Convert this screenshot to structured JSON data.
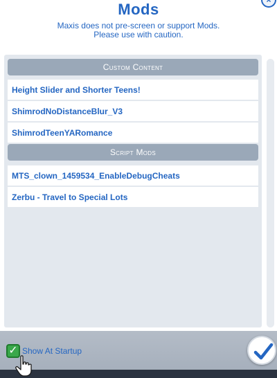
{
  "dialog": {
    "title": "Mods",
    "close_glyph": "×",
    "warning_line1": "Maxis does not pre-screen or support Mods.",
    "warning_line2": "Please use with caution."
  },
  "sections": {
    "custom_content": {
      "header": "Custom Content",
      "items": [
        "Height Slider and Shorter Teens!",
        "ShimrodNoDistanceBlur_V3",
        "ShimrodTeenYARomance"
      ]
    },
    "script_mods": {
      "header": "Script Mods",
      "items": [
        "MTS_clown_1459534_EnableDebugCheats",
        "Zerbu - Travel to Special Lots"
      ]
    }
  },
  "footer": {
    "show_at_startup_label": "Show At Startup",
    "show_at_startup_checked": true,
    "checkmark_glyph": "✓"
  },
  "icons": {
    "close": "close-icon",
    "checkbox": "checkmark-icon",
    "confirm": "checkmark-icon",
    "cursor": "hand-pointer-icon"
  },
  "colors": {
    "accent_blue": "#2466c2",
    "section_header_bg": "#9aa8b8",
    "panel_bg": "#e3e8ee",
    "checkbox_green": "#3aa84a",
    "footer_bg": "#a3adba"
  }
}
